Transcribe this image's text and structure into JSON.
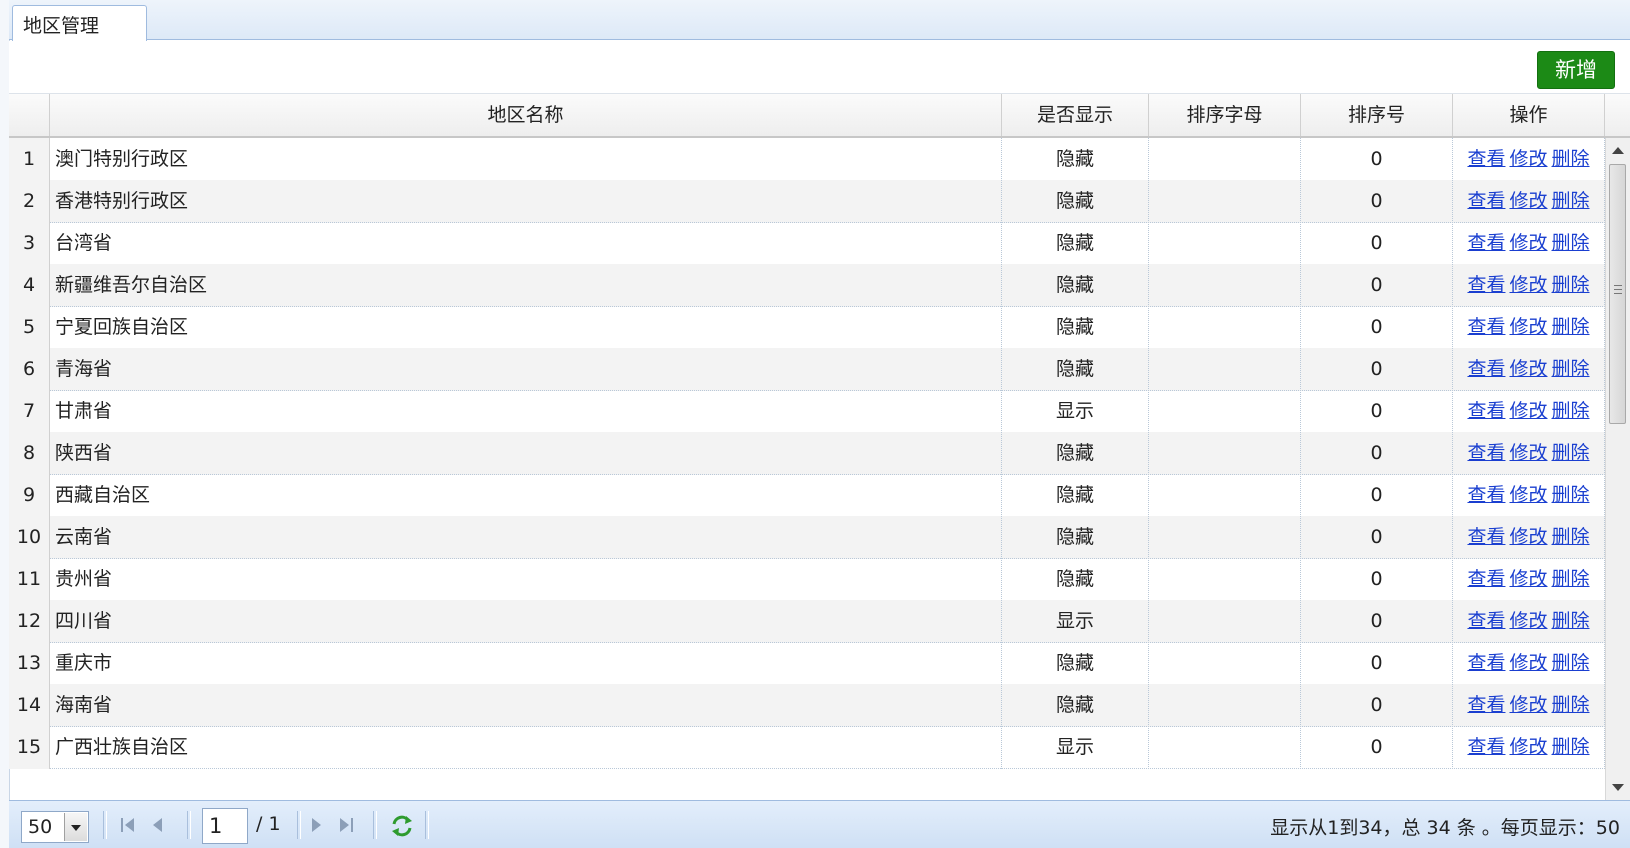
{
  "tab": {
    "title": "地区管理"
  },
  "toolbar": {
    "add_label": "新增"
  },
  "table": {
    "columns": [
      "地区名称",
      "是否显示",
      "排序字母",
      "排序号",
      "操作"
    ],
    "actions": [
      "查看",
      "修改",
      "删除"
    ],
    "rows": [
      {
        "num": "1",
        "name": "澳门特别行政区",
        "show": "隐藏",
        "letter": "",
        "order": "0"
      },
      {
        "num": "2",
        "name": "香港特别行政区",
        "show": "隐藏",
        "letter": "",
        "order": "0"
      },
      {
        "num": "3",
        "name": "台湾省",
        "show": "隐藏",
        "letter": "",
        "order": "0"
      },
      {
        "num": "4",
        "name": "新疆维吾尔自治区",
        "show": "隐藏",
        "letter": "",
        "order": "0"
      },
      {
        "num": "5",
        "name": "宁夏回族自治区",
        "show": "隐藏",
        "letter": "",
        "order": "0"
      },
      {
        "num": "6",
        "name": "青海省",
        "show": "隐藏",
        "letter": "",
        "order": "0"
      },
      {
        "num": "7",
        "name": "甘肃省",
        "show": "显示",
        "letter": "",
        "order": "0"
      },
      {
        "num": "8",
        "name": "陕西省",
        "show": "隐藏",
        "letter": "",
        "order": "0"
      },
      {
        "num": "9",
        "name": "西藏自治区",
        "show": "隐藏",
        "letter": "",
        "order": "0"
      },
      {
        "num": "10",
        "name": "云南省",
        "show": "隐藏",
        "letter": "",
        "order": "0"
      },
      {
        "num": "11",
        "name": "贵州省",
        "show": "隐藏",
        "letter": "",
        "order": "0"
      },
      {
        "num": "12",
        "name": "四川省",
        "show": "显示",
        "letter": "",
        "order": "0"
      },
      {
        "num": "13",
        "name": "重庆市",
        "show": "隐藏",
        "letter": "",
        "order": "0"
      },
      {
        "num": "14",
        "name": "海南省",
        "show": "隐藏",
        "letter": "",
        "order": "0"
      },
      {
        "num": "15",
        "name": "广西壮族自治区",
        "show": "显示",
        "letter": "",
        "order": "0"
      }
    ]
  },
  "pager": {
    "page_size": "50",
    "current_page": "1",
    "total_pages": "/ 1",
    "info": "显示从1到34，总 34 条 。每页显示：50"
  },
  "colors": {
    "add_button": "#1c8a16",
    "link": "#1a3fd0",
    "pager_bg": "#d8e6f7"
  },
  "icons": [
    "first-page-icon",
    "prev-page-icon",
    "next-page-icon",
    "last-page-icon",
    "refresh-icon"
  ]
}
